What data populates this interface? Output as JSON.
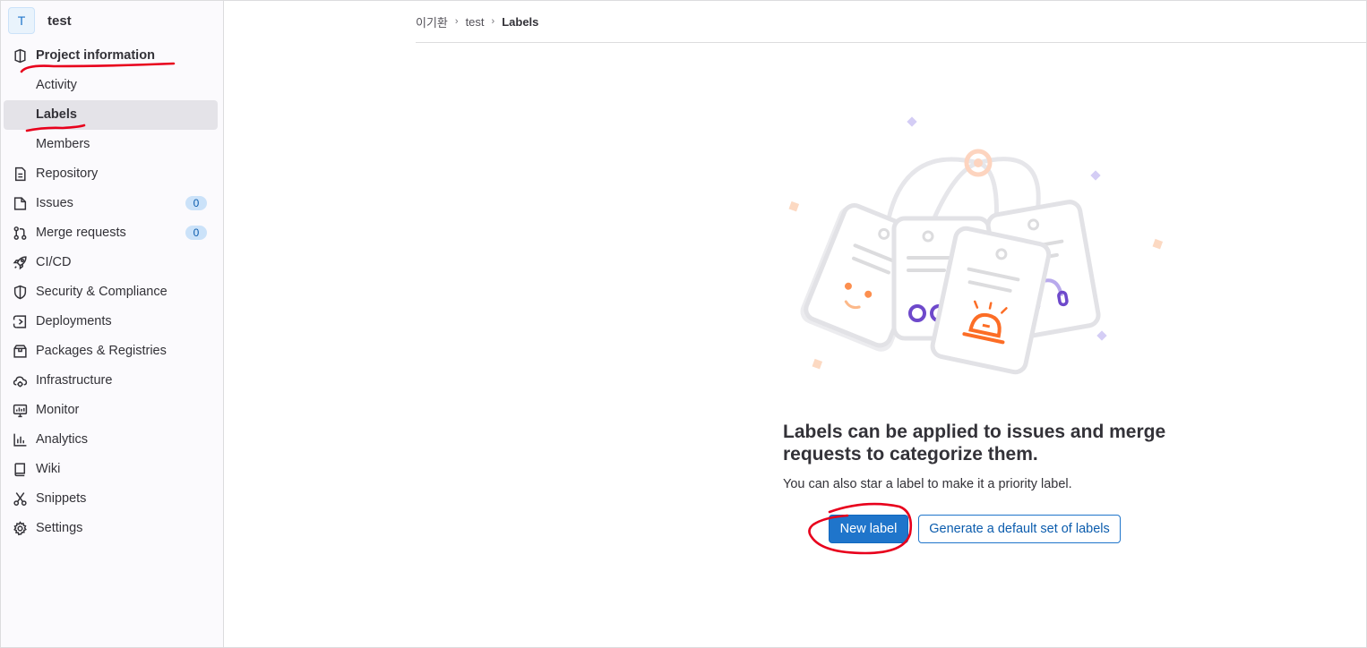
{
  "project": {
    "avatar_letter": "T",
    "name": "test"
  },
  "sidebar": {
    "items": [
      {
        "label": "Project information",
        "icon": "project-icon",
        "bold": true
      },
      {
        "label": "Activity",
        "sub": true
      },
      {
        "label": "Labels",
        "sub": true,
        "active": true
      },
      {
        "label": "Members",
        "sub": true
      },
      {
        "label": "Repository",
        "icon": "document-icon"
      },
      {
        "label": "Issues",
        "icon": "issues-icon",
        "badge": "0"
      },
      {
        "label": "Merge requests",
        "icon": "merge-request-icon",
        "badge": "0"
      },
      {
        "label": "CI/CD",
        "icon": "rocket-icon"
      },
      {
        "label": "Security & Compliance",
        "icon": "shield-icon"
      },
      {
        "label": "Deployments",
        "icon": "deployments-icon"
      },
      {
        "label": "Packages & Registries",
        "icon": "package-icon"
      },
      {
        "label": "Infrastructure",
        "icon": "cloud-gear-icon"
      },
      {
        "label": "Monitor",
        "icon": "monitor-icon"
      },
      {
        "label": "Analytics",
        "icon": "chart-icon"
      },
      {
        "label": "Wiki",
        "icon": "book-icon"
      },
      {
        "label": "Snippets",
        "icon": "scissors-icon"
      },
      {
        "label": "Settings",
        "icon": "gear-icon"
      }
    ]
  },
  "breadcrumb": {
    "owner": "이기환",
    "project": "test",
    "current": "Labels"
  },
  "empty_state": {
    "title": "Labels can be applied to issues and merge requests to categorize them.",
    "description": "You can also star a label to make it a priority label.",
    "primary_button": "New label",
    "secondary_button": "Generate a default set of labels"
  },
  "colors": {
    "accent": "#1f75cb",
    "annotation": "#e8001c",
    "illustration_orange": "#fc6d26",
    "illustration_purple": "#6e49cb"
  }
}
